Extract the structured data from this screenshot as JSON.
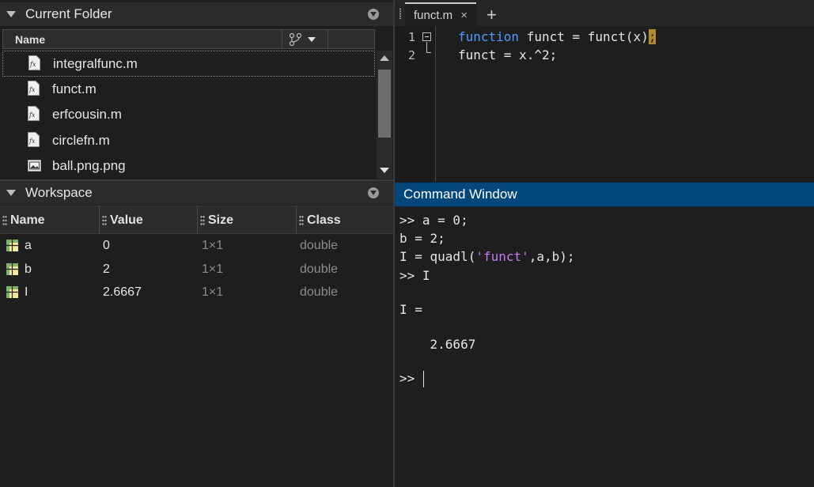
{
  "current_folder": {
    "title": "Current Folder",
    "column_name": "Name",
    "files": [
      {
        "name": "integralfunc.m",
        "type": "m"
      },
      {
        "name": "funct.m",
        "type": "m"
      },
      {
        "name": "erfcousin.m",
        "type": "m"
      },
      {
        "name": "circlefn.m",
        "type": "m"
      },
      {
        "name": "ball.png.png",
        "type": "png"
      }
    ]
  },
  "workspace": {
    "title": "Workspace",
    "columns": [
      "Name",
      "Value",
      "Size",
      "Class"
    ],
    "variables": [
      {
        "name": "a",
        "value": "0",
        "size": "1×1",
        "class": "double"
      },
      {
        "name": "b",
        "value": "2",
        "size": "1×1",
        "class": "double"
      },
      {
        "name": "I",
        "value": "2.6667",
        "size": "1×1",
        "class": "double"
      }
    ]
  },
  "editor": {
    "tab_label": "funct.m",
    "tab_close": "×",
    "add_tab": "+",
    "lines": [
      {
        "number": "1",
        "keyword": "function",
        "text": " funct = funct(x)",
        "highlight": ";"
      },
      {
        "number": "2",
        "keyword": "",
        "text": "funct = x.^2;",
        "highlight": ""
      }
    ]
  },
  "command_window": {
    "title": "Command Window",
    "lines": [
      ">> a = 0;",
      "b = 2;",
      "I = quadl(",
      ">> I",
      "I =",
      "    2.6667",
      ">> "
    ],
    "string_literal": "'funct'",
    "after_string": ",a,b);"
  },
  "colors": {
    "keyword": "#4e9bff",
    "string": "#c87bf0",
    "command_header": "#02477c"
  }
}
